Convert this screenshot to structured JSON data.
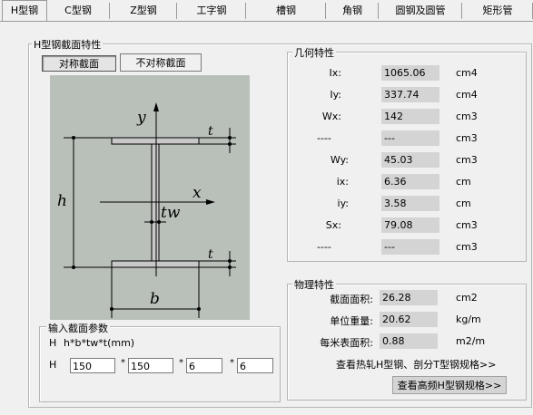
{
  "tabs": [
    "H型钢",
    "C型钢",
    "Z型钢",
    "工字钢",
    "槽钢",
    "角钢",
    "圆钢及圆管",
    "矩形管"
  ],
  "section_group": {
    "title": "H型钢截面特性"
  },
  "section_buttons": {
    "symmetric": "对称截面",
    "asymmetric": "不对称截面"
  },
  "drawing": {
    "y": "y",
    "x": "x",
    "h": "h",
    "b": "b",
    "tw": "tw",
    "t": "t"
  },
  "geo": {
    "title": "几何特性",
    "rows": [
      {
        "label": "Ix:",
        "value": "1065.06",
        "unit": "cm4"
      },
      {
        "label": "Iy:",
        "value": "337.74",
        "unit": "cm4"
      },
      {
        "label": "Wx:",
        "value": "142",
        "unit": "cm3"
      },
      {
        "label": "----",
        "value": "---",
        "unit": "cm3"
      },
      {
        "label": "Wy:",
        "value": "45.03",
        "unit": "cm3"
      },
      {
        "label": "ix:",
        "value": "6.36",
        "unit": "cm"
      },
      {
        "label": "iy:",
        "value": "3.58",
        "unit": "cm"
      },
      {
        "label": "Sx:",
        "value": "79.08",
        "unit": "cm3"
      },
      {
        "label": "----",
        "value": "---",
        "unit": "cm3"
      }
    ]
  },
  "phys": {
    "title": "物理特性",
    "rows": [
      {
        "label": "截面面积:",
        "value": "26.28",
        "unit": "cm2"
      },
      {
        "label": "单位重量:",
        "value": "20.62",
        "unit": "kg/m"
      },
      {
        "label": "每米表面积:",
        "value": "0.88",
        "unit": "m2/m"
      }
    ],
    "link1": "查看热轧H型钢、剖分T型钢规格>>",
    "link2": "查看高频H型钢规格>>"
  },
  "input_group": {
    "title": "输入截面参数",
    "formula_h": "H",
    "formula": "h*b*tw*t(mm)",
    "row_label": "H",
    "values": [
      "150",
      "150",
      "6",
      "6"
    ],
    "star": "*"
  }
}
